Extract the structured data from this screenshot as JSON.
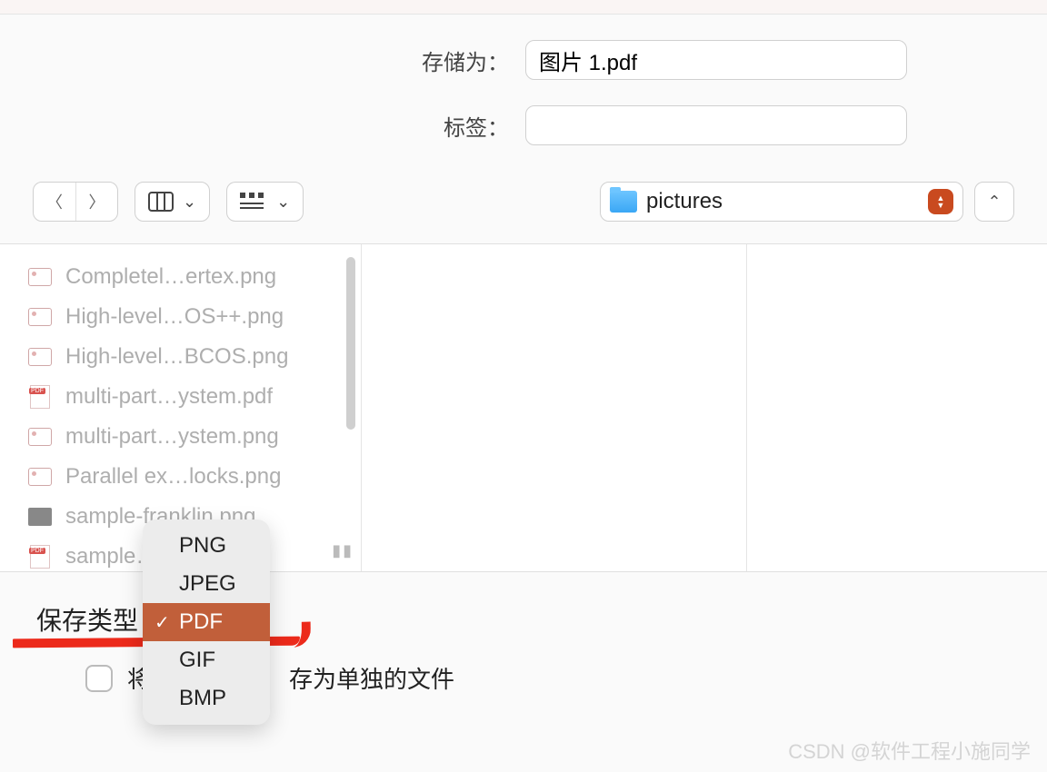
{
  "header": {
    "save_as_label": "存储为：",
    "filename": "图片 1.pdf",
    "tags_label": "标签："
  },
  "location": {
    "folder_name": "pictures"
  },
  "files": [
    {
      "icon": "png",
      "name": "Completel…ertex.png"
    },
    {
      "icon": "png",
      "name": "High-level…OS++.png"
    },
    {
      "icon": "png",
      "name": "High-level…BCOS.png"
    },
    {
      "icon": "pdf",
      "name": "multi-part…ystem.pdf"
    },
    {
      "icon": "png",
      "name": "multi-part…ystem.png"
    },
    {
      "icon": "png",
      "name": "Parallel ex…locks.png"
    },
    {
      "icon": "img",
      "name": "sample-franklin.png"
    },
    {
      "icon": "pdf",
      "name": "sample…"
    }
  ],
  "bottom": {
    "save_type_label": "保存类型",
    "checkbox_text_before": "将",
    "checkbox_text_after": "存为单独的文件"
  },
  "format_menu": {
    "items": [
      "PNG",
      "JPEG",
      "PDF",
      "GIF",
      "BMP"
    ],
    "selected": "PDF"
  },
  "watermark": "CSDN @软件工程小施同学"
}
